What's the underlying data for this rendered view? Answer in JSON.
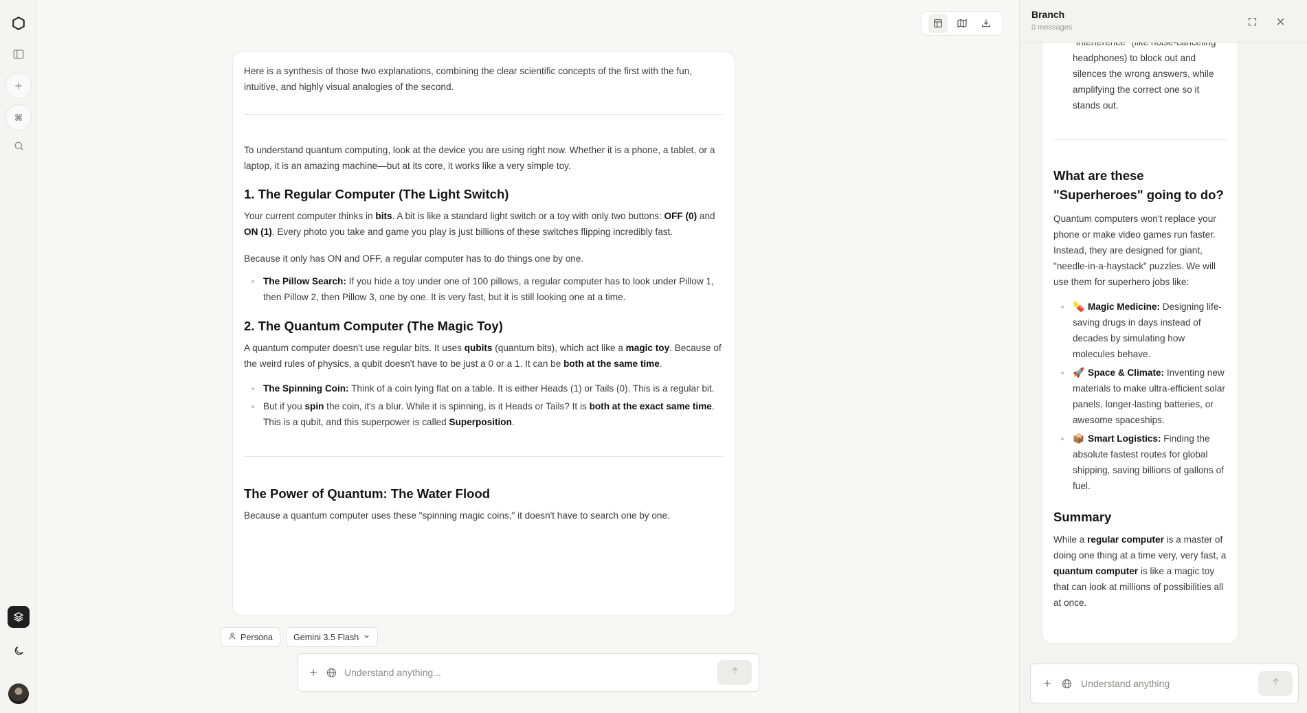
{
  "main": {
    "intro": "Here is a synthesis of those two explanations, combining the clear scientific concepts of the first with the fun, intuitive, and highly visual analogies of the second.",
    "p1": "To understand quantum computing, look at the device you are using right now. Whether it is a phone, a tablet, or a laptop, it is an amazing machine—but at its core, it works like a very simple toy.",
    "h1": "1. The Regular Computer (The Light Switch)",
    "p2": {
      "a": "Your current computer thinks in ",
      "b_bits": "bits",
      "c": ". A bit is like a standard light switch or a toy with only two buttons: ",
      "b_off": "OFF (0)",
      "d": " and ",
      "b_on": "ON (1)",
      "e": ". Every photo you take and game you play is just billions of these switches flipping incredibly fast."
    },
    "p3": "Because it only has ON and OFF, a regular computer has to do things one by one.",
    "list1": [
      {
        "bold": "The Pillow Search:",
        "text": " If you hide a toy under one of 100 pillows, a regular computer has to look under Pillow 1, then Pillow 2, then Pillow 3, one by one. It is very fast, but it is still looking one at a time."
      }
    ],
    "h2": "2. The Quantum Computer (The Magic Toy)",
    "p4": {
      "a": "A quantum computer doesn't use regular bits. It uses ",
      "b_qubits": "qubits",
      "c": " (quantum bits), which act like a ",
      "b_magic": "magic toy",
      "d": ". Because of the weird rules of physics, a qubit doesn't have to be just a 0 or a 1. It can be ",
      "b_both": "both at the same time",
      "e": "."
    },
    "list2": {
      "item1_bold": "The Spinning Coin:",
      "item1_text": " Think of a coin lying flat on a table. It is either Heads (1) or Tails (0). This is a regular bit.",
      "item2_a": "But if you ",
      "item2_b_spin": "spin",
      "item2_c": " the coin, it's a blur. While it is spinning, is it Heads or Tails? It is ",
      "item2_b_both": "both at the exact same time",
      "item2_d": ". This is a qubit, and this superpower is called ",
      "item2_b_super": "Superposition",
      "item2_e": "."
    },
    "h3": "The Power of Quantum: The Water Flood",
    "p5": "Because a quantum computer uses these \"spinning magic coins,\" it doesn't have to search one by one."
  },
  "composer": {
    "persona_label": "Persona",
    "model_label": "Gemini 3.5 Flash",
    "placeholder": "Understand anything..."
  },
  "branch": {
    "title": "Branch",
    "subtitle": "0 messages",
    "interference": "Quantum computers use \"interference\" (like noise-canceling headphones) to block out and silences the wrong answers, while amplifying the correct one so it stands out.",
    "h_superheroes": "What are these \"Superheroes\" going to do?",
    "p_superheroes": "Quantum computers won't replace your phone or make video games run faster. Instead, they are designed for giant, \"needle-in-a-haystack\" puzzles. We will use them for superhero jobs like:",
    "uses": [
      {
        "emoji": "💊",
        "bold": "Magic Medicine:",
        "text": " Designing life-saving drugs in days instead of decades by simulating how molecules behave."
      },
      {
        "emoji": "🚀",
        "bold": "Space & Climate:",
        "text": " Inventing new materials to make ultra-efficient solar panels, longer-lasting batteries, or awesome spaceships."
      },
      {
        "emoji": "📦",
        "bold": "Smart Logistics:",
        "text": " Finding the absolute fastest routes for global shipping, saving billions of gallons of fuel."
      }
    ],
    "h_summary": "Summary",
    "summary": {
      "a": "While a ",
      "b_regular": "regular computer",
      "c": " is a master of doing one thing at a time very, very fast, a ",
      "b_quantum": "quantum computer",
      "d": " is like a magic toy that can look at millions of possibilities all at once."
    },
    "placeholder": "Understand anything"
  }
}
